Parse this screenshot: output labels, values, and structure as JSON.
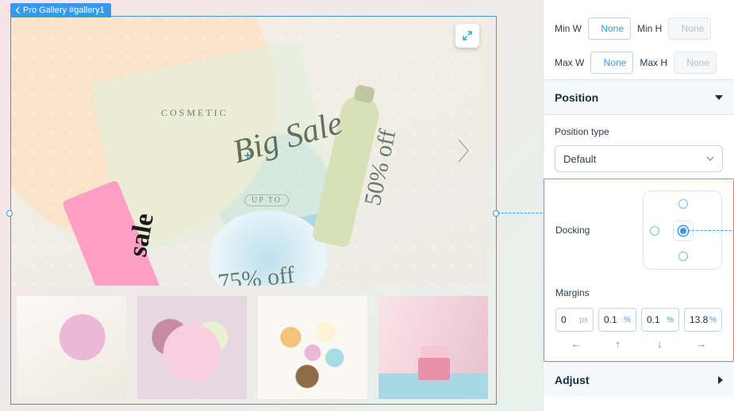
{
  "canvas": {
    "selection_label": "Pro Gallery #gallery1",
    "main_image": {
      "cosmetic": "COSMETIC",
      "big_sale": "Big Sale",
      "up_to": "UP TO",
      "seventyfive": "75% off",
      "fifty": "50% off",
      "sale": "sale"
    }
  },
  "inspector": {
    "size": {
      "minw_label": "Min W",
      "minw_value": "None",
      "minh_label": "Min H",
      "minh_value": "None",
      "maxw_label": "Max W",
      "maxw_value": "None",
      "maxh_label": "Max H",
      "maxh_value": "None"
    },
    "position": {
      "title": "Position",
      "type_label": "Position type",
      "type_value": "Default",
      "docking_label": "Docking",
      "margins_label": "Margins",
      "margins": {
        "top": {
          "value": "0",
          "unit": "px"
        },
        "right": {
          "value": "0.1",
          "unit": "%"
        },
        "bottom": {
          "value": "0.1",
          "unit": "%"
        },
        "left": {
          "value": "13.8",
          "unit": "%"
        }
      }
    },
    "adjust": {
      "title": "Adjust"
    }
  }
}
